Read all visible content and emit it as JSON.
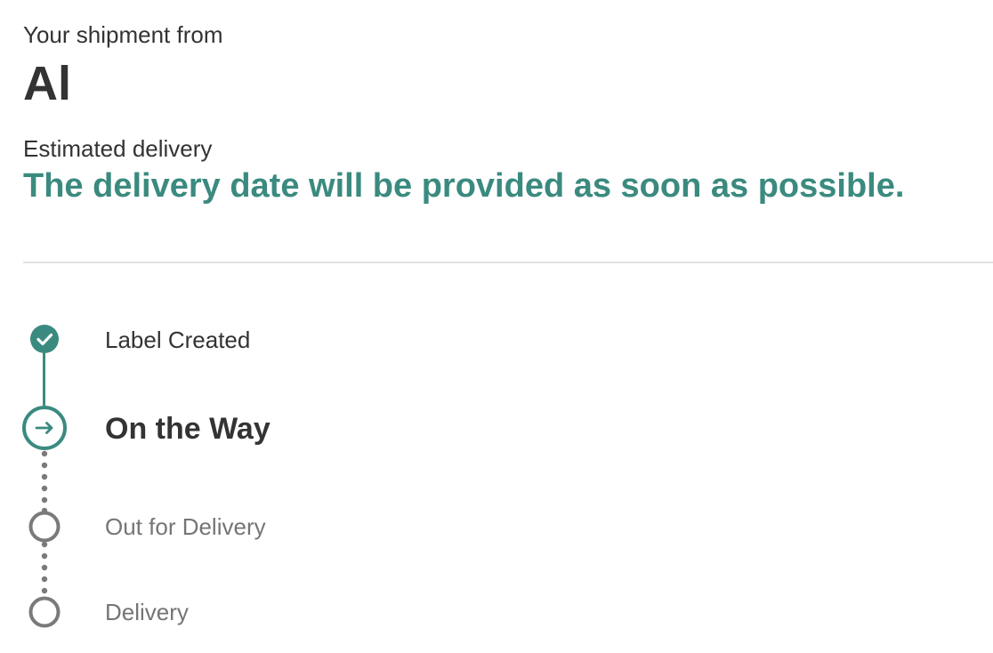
{
  "header": {
    "subtitle": "Your shipment from",
    "sender": "Al"
  },
  "estimate": {
    "label": "Estimated delivery",
    "value": "The delivery date will be provided as soon as possible."
  },
  "colors": {
    "accent": "#3b8a7f",
    "text": "#333333",
    "muted": "#757575",
    "pending": "#7a7a7a",
    "divider": "#e2e2e2"
  },
  "steps": [
    {
      "label": "Label Created",
      "status": "done",
      "icon": "check-circle-icon"
    },
    {
      "label": "On the Way",
      "status": "current",
      "icon": "arrow-right-circle-icon"
    },
    {
      "label": "Out for Delivery",
      "status": "pending",
      "icon": "empty-circle-icon"
    },
    {
      "label": "Delivery",
      "status": "pending",
      "icon": "empty-circle-icon"
    }
  ]
}
